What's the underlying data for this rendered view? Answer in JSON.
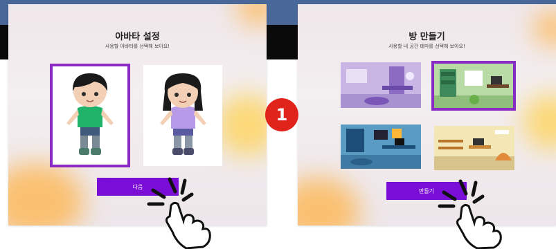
{
  "left_screen": {
    "title": "아바타 설정",
    "subtitle": "사용할 아바타를 선택해 보아요!",
    "options": [
      {
        "name": "boy-avatar",
        "selected": true
      },
      {
        "name": "girl-avatar",
        "selected": false
      }
    ],
    "button_label": "다음"
  },
  "right_screen": {
    "title": "방 만들기",
    "subtitle": "사용할 내 공간 테마를 선택해 보아요!",
    "themes": [
      {
        "name": "purple-room",
        "selected": false
      },
      {
        "name": "green-room",
        "selected": true
      },
      {
        "name": "blue-room",
        "selected": false
      },
      {
        "name": "yellow-room",
        "selected": false
      }
    ],
    "button_label": "만들기"
  },
  "step_marker": "1",
  "colors": {
    "accent": "#7a0ed6",
    "selection": "#8a2bc4",
    "marker": "#e0241c"
  },
  "icons": [
    "tap-hand-icon",
    "click-burst-icon"
  ]
}
